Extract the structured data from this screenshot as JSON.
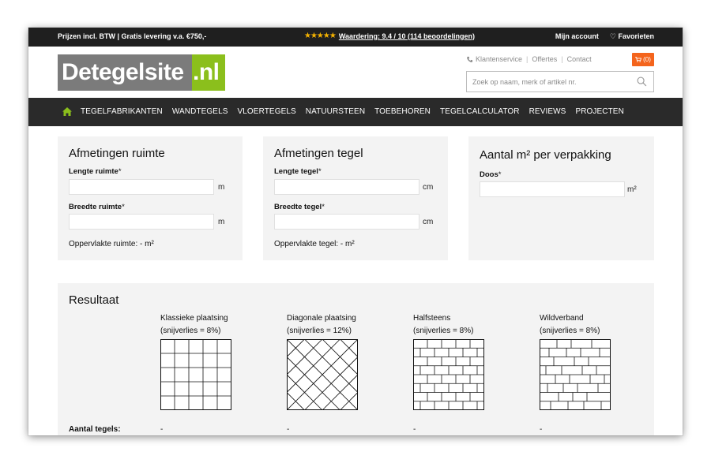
{
  "topbar": {
    "left_text": "Prijzen incl. BTW | Gratis levering v.a. €750,-",
    "stars": "★★★★★",
    "rating": "Waardering: 9.4 / 10 (114 beoordelingen)",
    "account": "Mijn account",
    "favorites": "Favorieten"
  },
  "header": {
    "logo_main": "Detegelsite",
    "logo_tld": ".nl",
    "customer_service": "Klantenservice",
    "quotes": "Offertes",
    "contact": "Contact",
    "cart_count": "(0)",
    "search_placeholder": "Zoek op naam, merk of artikel nr."
  },
  "nav": {
    "items": [
      "TEGELFABRIKANTEN",
      "WANDTEGELS",
      "VLOERTEGELS",
      "NATUURSTEEN",
      "TOEBEHOREN",
      "TEGELCALCULATOR",
      "REVIEWS",
      "PROJECTEN"
    ]
  },
  "room": {
    "title": "Afmetingen ruimte",
    "length_label": "Lengte ruimte",
    "width_label": "Breedte ruimte",
    "required_mark": "*",
    "unit": "m",
    "area_text": "Oppervlakte ruimte: - m²"
  },
  "tile": {
    "title": "Afmetingen tegel",
    "length_label": "Lengte tegel",
    "width_label": "Breedte tegel",
    "required_mark": "*",
    "unit": "cm",
    "area_text": "Oppervlakte tegel: - m²"
  },
  "package": {
    "title": "Aantal m² per verpakking",
    "box_label": "Doos",
    "required_mark": "*",
    "unit": "m²"
  },
  "result": {
    "title": "Resultaat",
    "count_label": "Aantal tegels:",
    "patterns": [
      {
        "name": "Klassieke plaatsing",
        "loss": "(snijverlies = 8%)",
        "count": "-"
      },
      {
        "name": "Diagonale plaatsing",
        "loss": "(snijverlies = 12%)",
        "count": "-"
      },
      {
        "name": "Halfsteens",
        "loss": "(snijverlies = 8%)",
        "count": "-"
      },
      {
        "name": "Wildverband",
        "loss": "(snijverlies = 8%)",
        "count": "-"
      }
    ]
  },
  "colors": {
    "topbar": "#1f1f1f",
    "nav": "#2a2a2a",
    "accent_green": "#8bbf1c",
    "cart_orange": "#f4641c",
    "panel_bg": "#f3f3f3"
  }
}
